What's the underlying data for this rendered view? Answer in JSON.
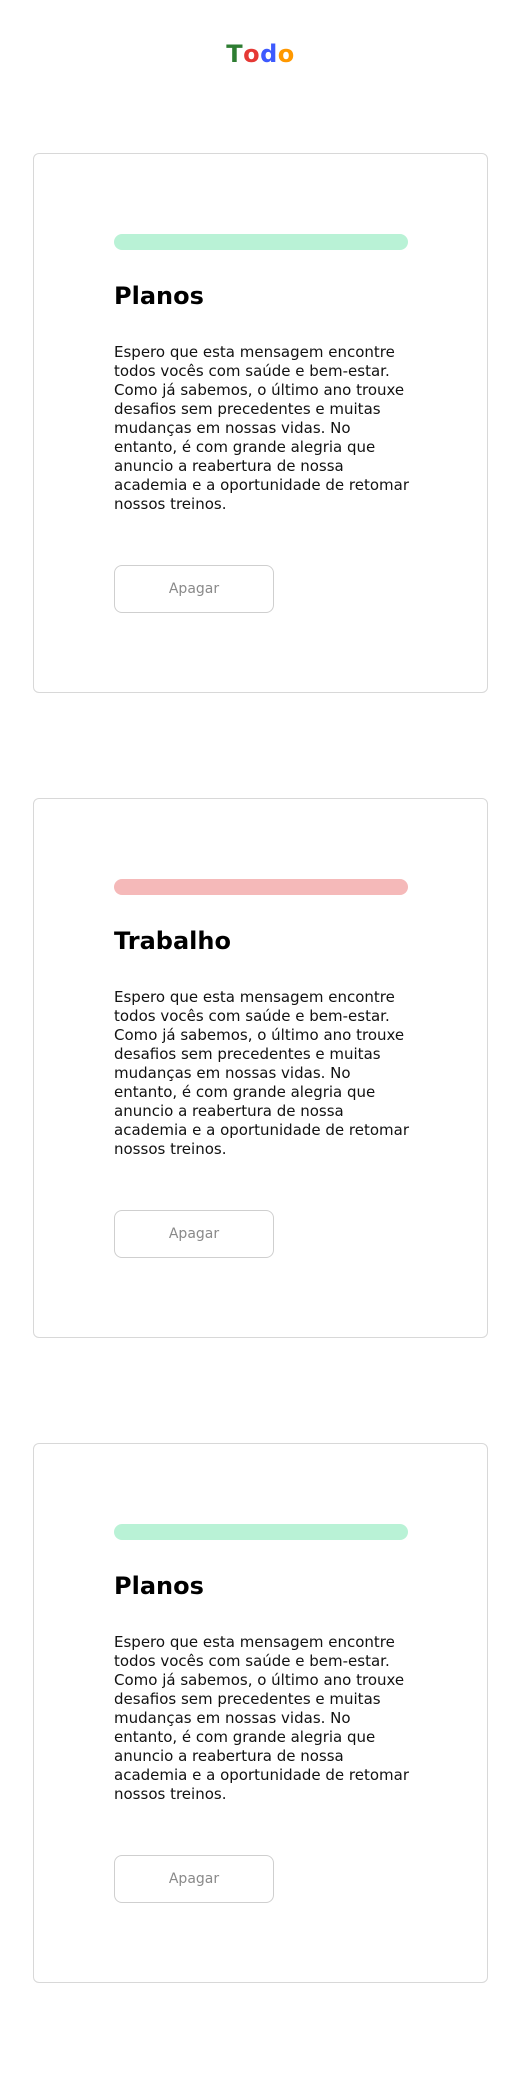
{
  "header": {
    "logo_letters": [
      {
        "char": "T",
        "color": "#2e7d32"
      },
      {
        "char": "o",
        "color": "#e53935"
      },
      {
        "char": "d",
        "color": "#3d5afe"
      },
      {
        "char": "o",
        "color": "#ff9800"
      }
    ]
  },
  "cards": [
    {
      "tag_color": "#b9f2d6",
      "title": "Planos",
      "body": "Espero que esta mensagem encontre todos vocês com saúde e bem-estar. Como já sabemos, o último ano trouxe desafios sem precedentes e muitas mudanças em nossas vidas. No entanto, é com grande alegria que anuncio a reabertura de nossa academia e a oportunidade de retomar nossos treinos.",
      "button_label": "Apagar"
    },
    {
      "tag_color": "#f5b9b9",
      "title": "Trabalho",
      "body": "Espero que esta mensagem encontre todos vocês com saúde e bem-estar. Como já sabemos, o último ano trouxe desafios sem precedentes e muitas mudanças em nossas vidas. No entanto, é com grande alegria que anuncio a reabertura de nossa academia e a oportunidade de retomar nossos treinos.",
      "button_label": "Apagar"
    },
    {
      "tag_color": "#b9f2d6",
      "title": "Planos",
      "body": "Espero que esta mensagem encontre todos vocês com saúde e bem-estar. Como já sabemos, o último ano trouxe desafios sem precedentes e muitas mudanças em nossas vidas. No entanto, é com grande alegria que anuncio a reabertura de nossa academia e a oportunidade de retomar nossos treinos.",
      "button_label": "Apagar"
    }
  ]
}
